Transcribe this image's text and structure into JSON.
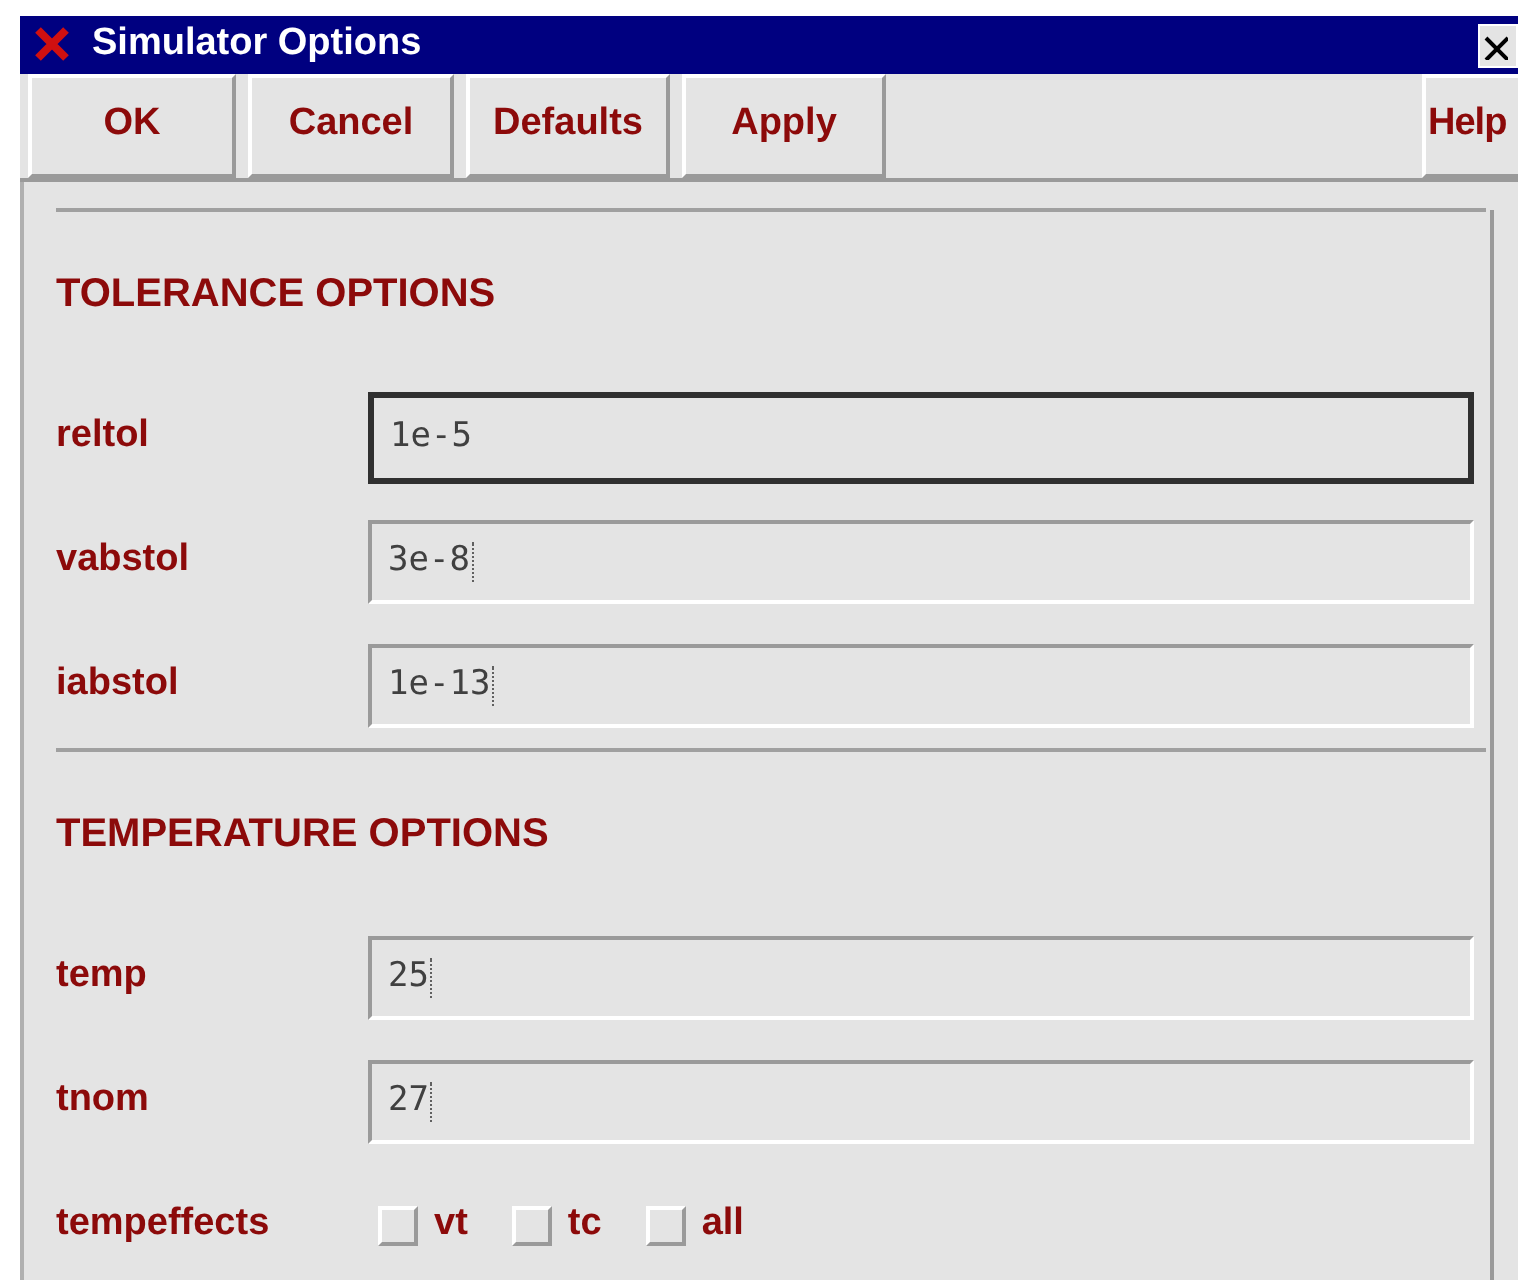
{
  "window": {
    "title": "Simulator Options"
  },
  "buttons": [
    "OK",
    "Cancel",
    "Defaults",
    "Apply"
  ],
  "help_button": "Help",
  "sections": [
    {
      "title": "TOLERANCE OPTIONS",
      "fields": [
        {
          "label": "reltol",
          "value": "1e-5",
          "focused": true
        },
        {
          "label": "vabstol",
          "value": "3e-8",
          "focused": false
        },
        {
          "label": "iabstol",
          "value": "1e-13",
          "focused": false
        }
      ]
    },
    {
      "title": "TEMPERATURE OPTIONS",
      "fields": [
        {
          "label": "temp",
          "value": "25",
          "focused": false
        },
        {
          "label": "tnom",
          "value": "27",
          "focused": false
        }
      ],
      "checkbox_group": {
        "label": "tempeffects",
        "options": [
          {
            "label": "vt",
            "checked": false
          },
          {
            "label": "tc",
            "checked": false
          },
          {
            "label": "all",
            "checked": false
          }
        ]
      }
    }
  ]
}
